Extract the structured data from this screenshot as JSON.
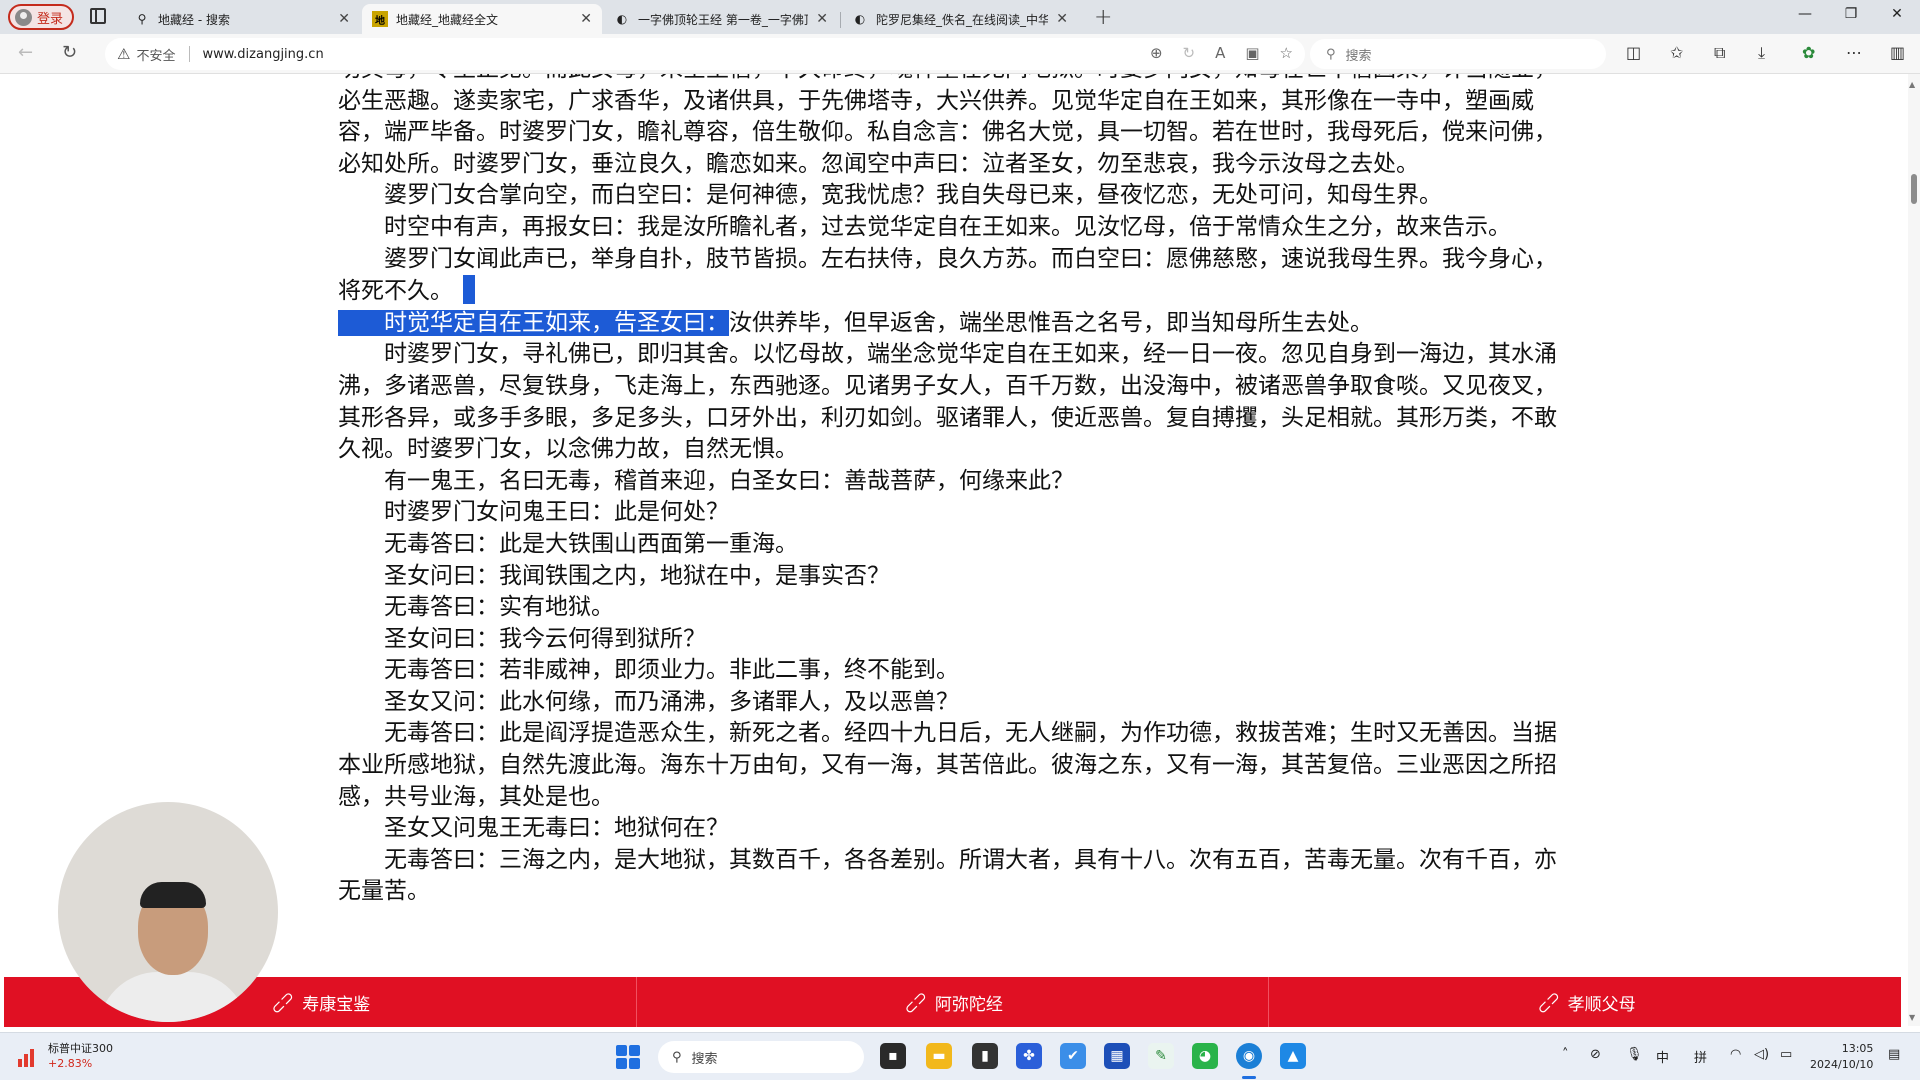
{
  "browser": {
    "profile_label": "登录",
    "tabs": [
      {
        "title": "地藏经 - 搜索",
        "favicon": "search-icon"
      },
      {
        "title": "地藏经_地藏经全文",
        "favicon": "site-logo-icon",
        "favicon_text": "地"
      },
      {
        "title": "一字佛顶轮王经 第一卷_一字佛顶",
        "favicon": "page-icon"
      },
      {
        "title": "陀罗尼集经_佚名_在线阅读_中华典",
        "favicon": "page-icon"
      }
    ],
    "address": {
      "security_label": "不安全",
      "url": "www.dizangjing.cn"
    },
    "search_placeholder": "搜索"
  },
  "article": {
    "paragraphs": [
      {
        "indent": false,
        "text": "功其母，令生正见。而此女母，未全生信，不久命终，魂神堕在无间地狱。时婆罗门女，知母在世不信因果，计当随业，必生恶趣。遂卖家宅，广求香华，及诸供具，于先佛塔寺，大兴供养。见觉华定自在王如来，其形像在一寺中，塑画威容，端严毕备。时婆罗门女，瞻礼尊容，倍生敬仰。私自念言：佛名大觉，具一切智。若在世时，我母死后，傥来问佛，必知处所。时婆罗门女，垂泣良久，瞻恋如来。忽闻空中声曰：泣者圣女，勿至悲哀，我今示汝母之去处。"
      },
      {
        "indent": true,
        "text": "婆罗门女合掌向空，而白空曰：是何神德，宽我忧虑？我自失母已来，昼夜忆恋，无处可问，知母生界。"
      },
      {
        "indent": true,
        "text": "时空中有声，再报女曰：我是汝所瞻礼者，过去觉华定自在王如来。见汝忆母，倍于常情众生之分，故来告示。"
      },
      {
        "indent": true,
        "text": "婆罗门女闻此声已，举身自扑，肢节皆损。左右扶侍，良久方苏。而白空曰：愿佛慈愍，速说我母生界。我今身心，将死不久。"
      }
    ],
    "highlighted_text": "时觉华定自在王如来，告圣女曰：",
    "highlighted_rest": "汝供养毕，但早返舍，端坐思惟吾之名号，即当知母所生去处。",
    "paragraphs_after": [
      {
        "indent": true,
        "text": "时婆罗门女，寻礼佛已，即归其舍。以忆母故，端坐念觉华定自在王如来，经一日一夜。忽见自身到一海边，其水涌沸，多诸恶兽，尽复铁身，飞走海上，东西驰逐。见诸男子女人，百千万数，出没海中，被诸恶兽争取食啖。又见夜叉，其形各异，或多手多眼，多足多头，口牙外出，利刃如剑。驱诸罪人，使近恶兽。复自搏攫，头足相就。其形万类，不敢久视。时婆罗门女，以念佛力故，自然无惧。"
      },
      {
        "indent": true,
        "text": "有一鬼王，名曰无毒，稽首来迎，白圣女曰：善哉菩萨，何缘来此？"
      },
      {
        "indent": true,
        "text": "时婆罗门女问鬼王曰：此是何处？"
      },
      {
        "indent": true,
        "text": "无毒答曰：此是大铁围山西面第一重海。"
      },
      {
        "indent": true,
        "text": "圣女问曰：我闻铁围之内，地狱在中，是事实否？"
      },
      {
        "indent": true,
        "text": "无毒答曰：实有地狱。"
      },
      {
        "indent": true,
        "text": "圣女问曰：我今云何得到狱所？"
      },
      {
        "indent": true,
        "text": "无毒答曰：若非威神，即须业力。非此二事，终不能到。"
      },
      {
        "indent": true,
        "text": "圣女又问：此水何缘，而乃涌沸，多诸罪人，及以恶兽？"
      },
      {
        "indent": true,
        "text": "无毒答曰：此是阎浮提造恶众生，新死之者。经四十九日后，无人继嗣，为作功德，救拔苦难；生时又无善因。当据本业所感地狱，自然先渡此海。海东十万由旬，又有一海，其苦倍此。彼海之东，又有一海，其苦复倍。三业恶因之所招感，共号业海，其处是也。"
      },
      {
        "indent": true,
        "text": "圣女又问鬼王无毒曰：地狱何在？"
      },
      {
        "indent": true,
        "text": "无毒答曰：三海之内，是大地狱，其数百千，各各差别。所谓大者，具有十八。次有五百，苦毒无量。次有千百，亦无量苦。"
      }
    ]
  },
  "link_bar": {
    "links": [
      {
        "label": "寿康宝鉴",
        "icon": "link-icon"
      },
      {
        "label": "阿弥陀经",
        "icon": "link-icon"
      },
      {
        "label": "孝顺父母",
        "icon": "link-icon"
      }
    ],
    "color": "#e01023"
  },
  "taskbar": {
    "widget_name": "标普中证300",
    "widget_change": "+2.83%",
    "search_placeholder": "搜索",
    "tray": {
      "ime_lang": "中",
      "ime_mode": "拼"
    },
    "time": "13:05",
    "date": "2024/10/10"
  },
  "colors": {
    "selection": "#1d5bd6",
    "accent": "#1f6fe0"
  }
}
